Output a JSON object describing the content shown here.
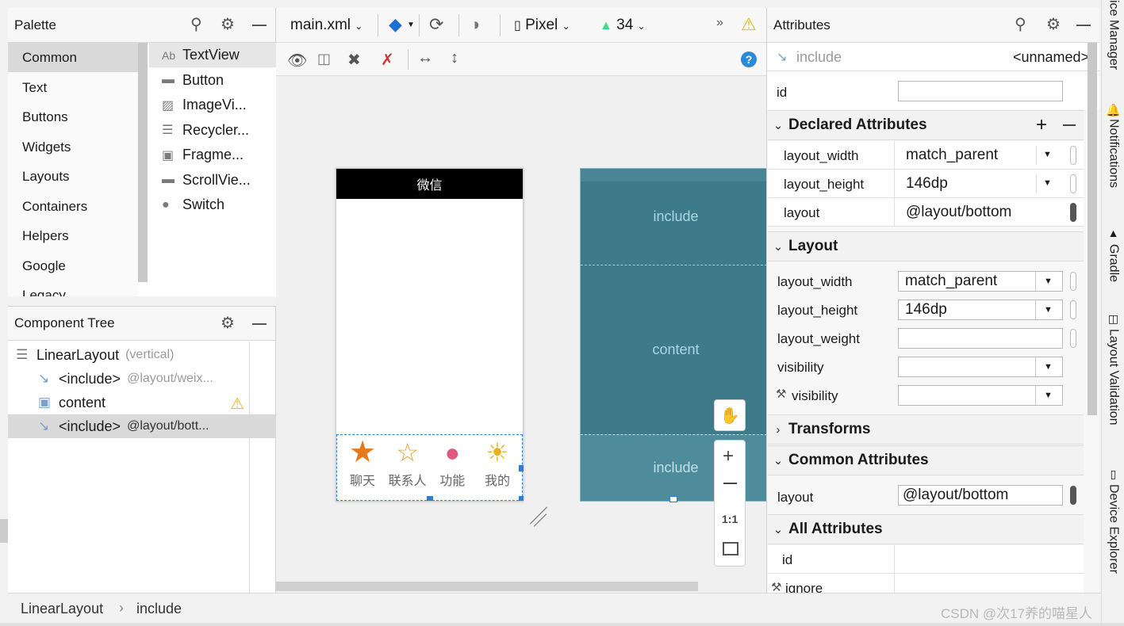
{
  "palette": {
    "title": "Palette",
    "categories": [
      "Common",
      "Text",
      "Buttons",
      "Widgets",
      "Layouts",
      "Containers",
      "Helpers",
      "Google",
      "Legacy"
    ],
    "widgets": [
      {
        "icon": "text-icon",
        "glyph": "Ab",
        "label": "TextView"
      },
      {
        "icon": "button-icon",
        "glyph": "▬",
        "label": "Button"
      },
      {
        "icon": "image-icon",
        "glyph": "▨",
        "label": "ImageVi..."
      },
      {
        "icon": "list-icon",
        "glyph": "☰",
        "label": "Recycler..."
      },
      {
        "icon": "fragment-icon",
        "glyph": "▣",
        "label": "Fragme..."
      },
      {
        "icon": "scroll-icon",
        "glyph": "▬",
        "label": "ScrollVie..."
      },
      {
        "icon": "switch-icon",
        "glyph": "●",
        "label": "Switch"
      }
    ]
  },
  "component_tree": {
    "title": "Component Tree",
    "items": [
      {
        "label": "LinearLayout",
        "hint": "(vertical)"
      },
      {
        "label": "<include>",
        "hint": "@layout/weix..."
      },
      {
        "label": "content",
        "hint": ""
      },
      {
        "label": "<include>",
        "hint": "@layout/bott..."
      }
    ]
  },
  "toolbar": {
    "file": "main.xml",
    "device": "Pixel",
    "api": "34"
  },
  "phone": {
    "title": "微信",
    "tabs": [
      {
        "label": "聊天",
        "icon": "star-icon"
      },
      {
        "label": "联系人",
        "icon": "bulb-icon"
      },
      {
        "label": "功能",
        "icon": "orb-icon"
      },
      {
        "label": "我的",
        "icon": "sun-icon"
      }
    ]
  },
  "blueprint": {
    "top": "include",
    "middle": "content",
    "bottom": "include"
  },
  "zoom": {
    "one_to_one": "1:1"
  },
  "attributes": {
    "title": "Attributes",
    "component": "include",
    "component_id": "<unnamed>",
    "id_label": "id",
    "declared_title": "Declared Attributes",
    "declared": [
      {
        "name": "layout_width",
        "value": "match_parent"
      },
      {
        "name": "layout_height",
        "value": "146dp"
      },
      {
        "name": "layout",
        "value": "@layout/bottom"
      }
    ],
    "layout_title": "Layout",
    "layout": [
      {
        "name": "layout_width",
        "value": "match_parent"
      },
      {
        "name": "layout_height",
        "value": "146dp"
      },
      {
        "name": "layout_weight",
        "value": ""
      },
      {
        "name": "visibility",
        "value": ""
      },
      {
        "name": "visibility",
        "value": ""
      }
    ],
    "transforms_title": "Transforms",
    "common_title": "Common Attributes",
    "common": [
      {
        "name": "layout",
        "value": "@layout/bottom"
      }
    ],
    "all_title": "All Attributes",
    "all": [
      {
        "name": "id"
      },
      {
        "name": "ignore"
      }
    ]
  },
  "side_tabs": [
    "ice Manager",
    "Notifications",
    "Gradle",
    "Layout Validation",
    "Device Explorer"
  ],
  "breadcrumb": [
    "LinearLayout",
    "include"
  ],
  "watermark": "CSDN @次17养的喵星人",
  "colors": {
    "blueprint": "#3d7a8a",
    "blueprint_sel": "#4e8c9c",
    "selection": "#2a7fd4",
    "warning": "#f2b20c"
  }
}
